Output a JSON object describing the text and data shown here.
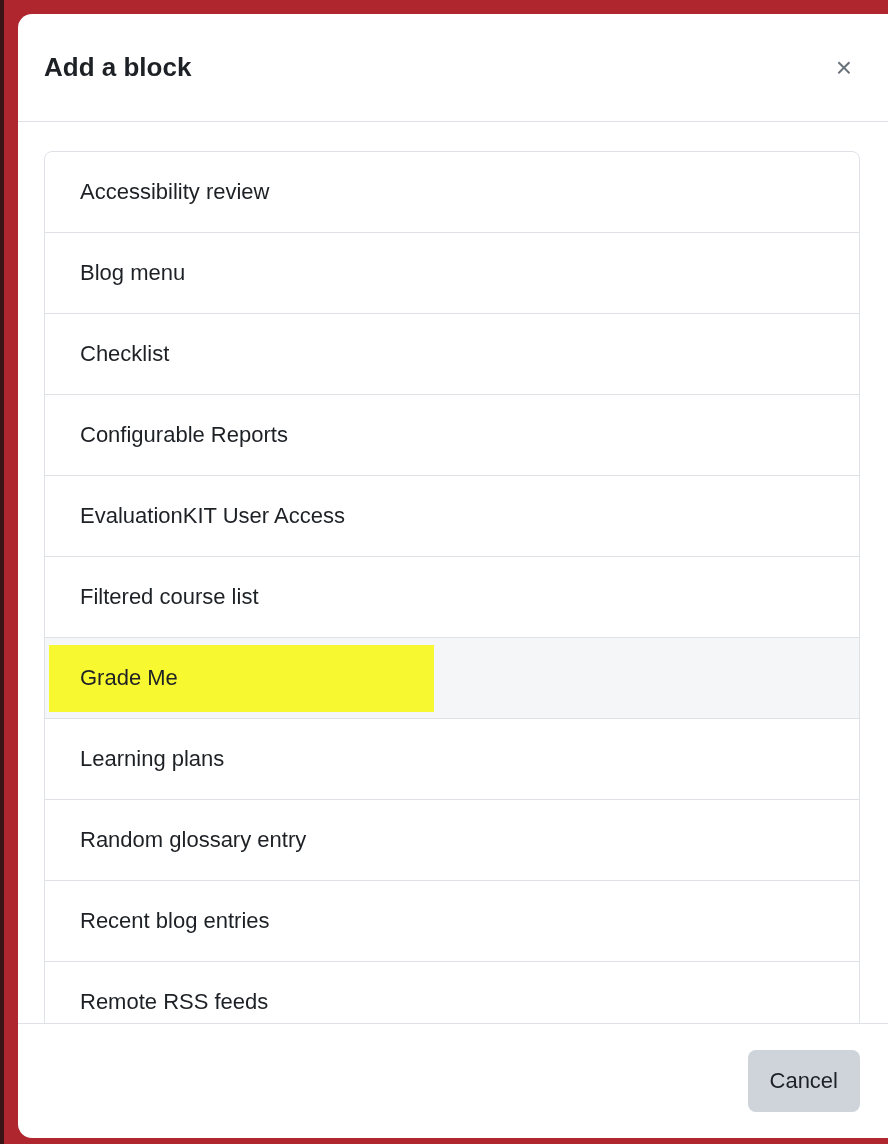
{
  "dialog": {
    "title": "Add a block",
    "close": "×",
    "items": [
      {
        "label": "Accessibility review",
        "hovered": false,
        "highlighted": false
      },
      {
        "label": "Blog menu",
        "hovered": false,
        "highlighted": false
      },
      {
        "label": "Checklist",
        "hovered": false,
        "highlighted": false
      },
      {
        "label": "Configurable Reports",
        "hovered": false,
        "highlighted": false
      },
      {
        "label": "EvaluationKIT User Access",
        "hovered": false,
        "highlighted": false
      },
      {
        "label": "Filtered course list",
        "hovered": false,
        "highlighted": false
      },
      {
        "label": "Grade Me",
        "hovered": true,
        "highlighted": true
      },
      {
        "label": "Learning plans",
        "hovered": false,
        "highlighted": false
      },
      {
        "label": "Random glossary entry",
        "hovered": false,
        "highlighted": false
      },
      {
        "label": "Recent blog entries",
        "hovered": false,
        "highlighted": false
      },
      {
        "label": "Remote RSS feeds",
        "hovered": false,
        "highlighted": false
      }
    ],
    "buttons": [
      "Cancel"
    ]
  }
}
